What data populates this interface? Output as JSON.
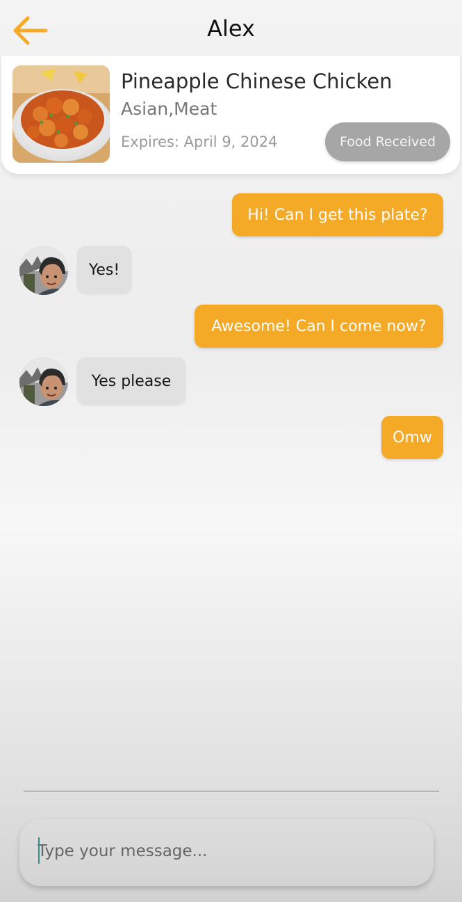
{
  "header": {
    "back_icon": "arrow-left-icon",
    "title": "Alex"
  },
  "food_card": {
    "image_icon": "food-photo",
    "title": "Pineapple Chinese Chicken",
    "tags": "Asian,Meat",
    "expiry": "Expires: April 9, 2024",
    "status_button_label": "Food Received"
  },
  "messages": [
    {
      "direction": "outgoing",
      "text": "Hi! Can I get this plate?"
    },
    {
      "direction": "incoming",
      "text": "Yes!"
    },
    {
      "direction": "outgoing",
      "text": "Awesome! Can I come now?"
    },
    {
      "direction": "incoming",
      "text": "Yes please"
    },
    {
      "direction": "outgoing",
      "text": "Omw"
    }
  ],
  "composer": {
    "placeholder": "Type your message...",
    "value": ""
  },
  "colors": {
    "accent": "#f4aa27",
    "incoming_bubble": "#e1e1e1",
    "status_button": "#a6a6a6",
    "caret": "#2f8f8a"
  }
}
